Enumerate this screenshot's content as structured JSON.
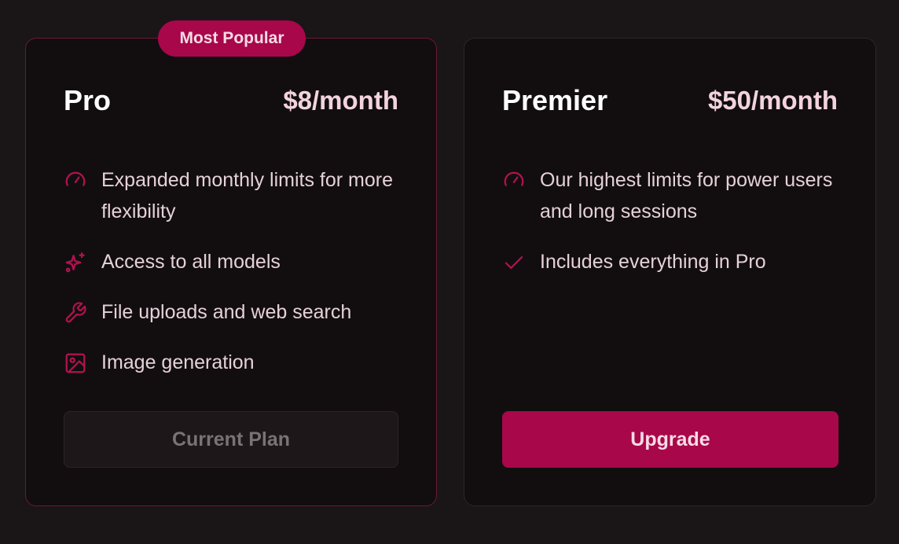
{
  "plans": [
    {
      "name": "Pro",
      "price": "$8/month",
      "badge": "Most Popular",
      "features": [
        {
          "icon": "gauge-icon",
          "text": "Expanded monthly limits for more flexibility"
        },
        {
          "icon": "sparkles-icon",
          "text": "Access to all models"
        },
        {
          "icon": "wrench-icon",
          "text": "File uploads and web search"
        },
        {
          "icon": "image-icon",
          "text": "Image generation"
        }
      ],
      "button_label": "Current Plan"
    },
    {
      "name": "Premier",
      "price": "$50/month",
      "features": [
        {
          "icon": "gauge-icon",
          "text": "Our highest limits for power users and long sessions"
        },
        {
          "icon": "check-icon",
          "text": "Includes everything in Pro"
        }
      ],
      "button_label": "Upgrade"
    }
  ],
  "colors": {
    "background": "#1a1517",
    "card": "#120e10",
    "accent": "#a8074a",
    "icon": "#b3124f",
    "highlight_border": "#6e1838"
  }
}
